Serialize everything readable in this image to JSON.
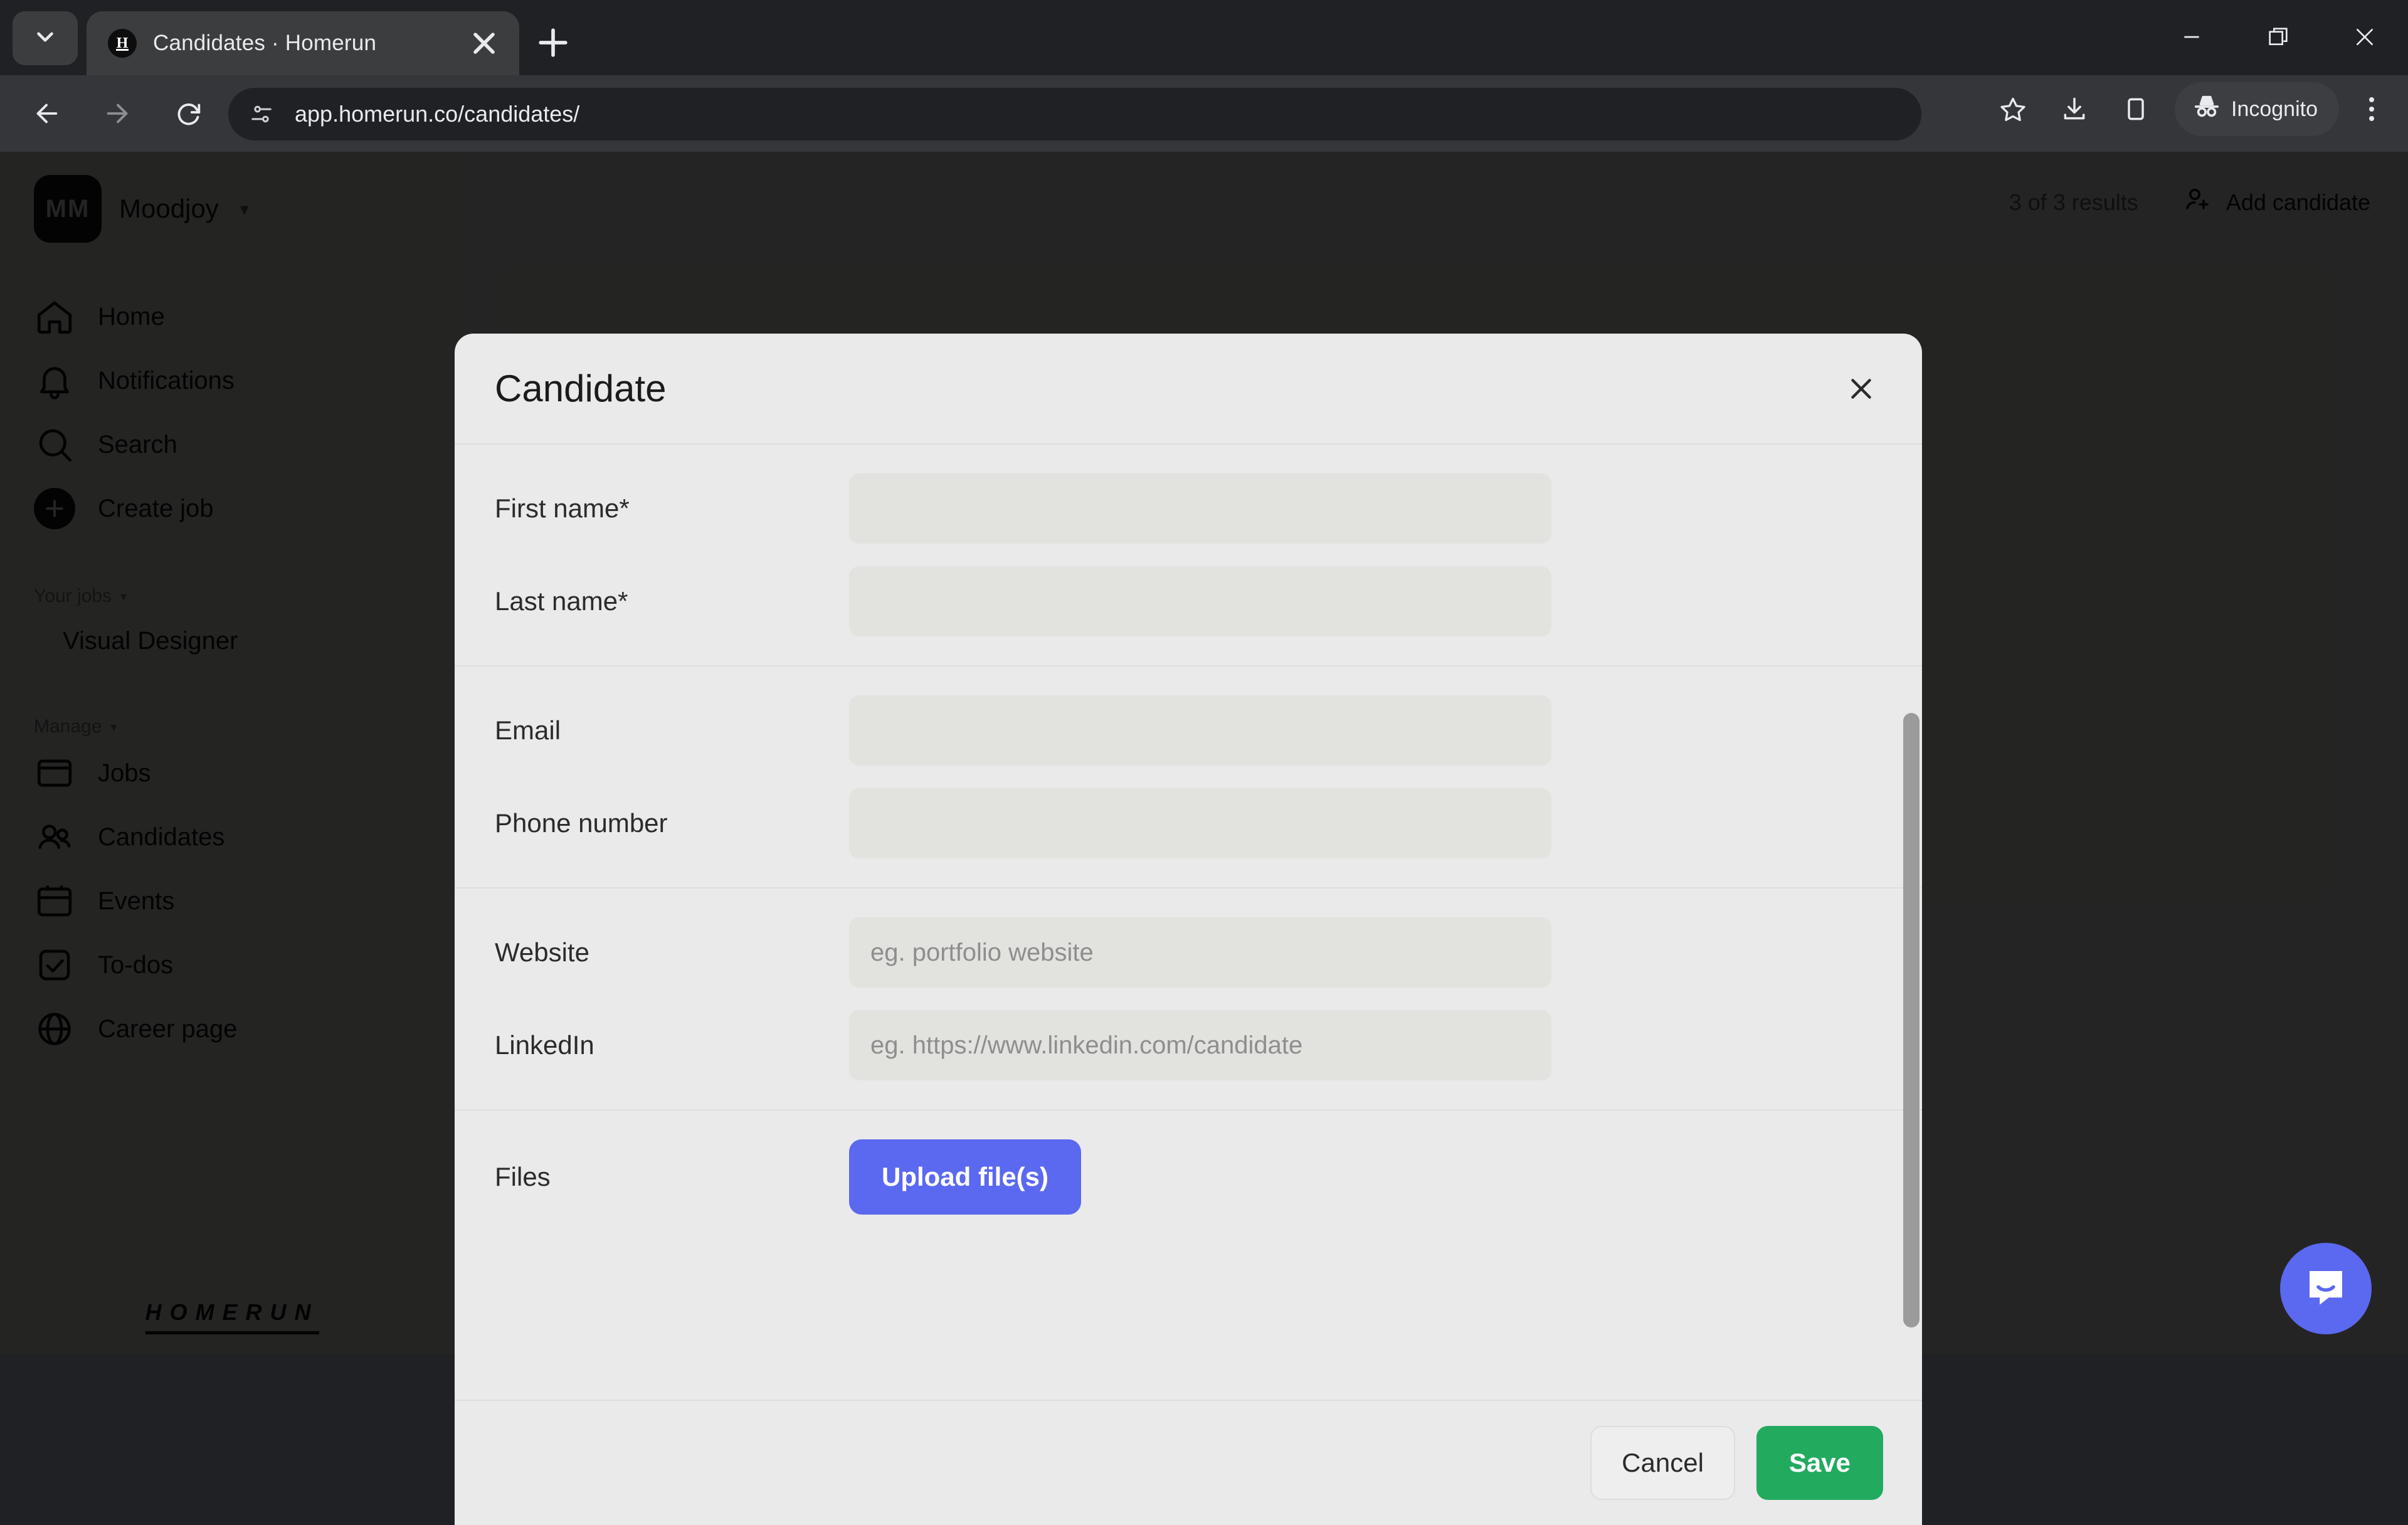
{
  "browser": {
    "tab": {
      "title": "Candidates · Homerun",
      "favicon_letter": "H"
    },
    "tab_list_icon": "chevron-down-icon",
    "new_tab_label": "+",
    "close_tab_label": "×",
    "window_controls": {
      "minimize": "minimize-icon",
      "maximize": "restore-icon",
      "close": "close-icon"
    },
    "omnibox": {
      "url": "app.homerun.co/candidates/",
      "site_info_icon": "tune-icon"
    },
    "toolbar_right": {
      "bookmark_icon": "star-icon",
      "downloads_icon": "download-icon",
      "side_panel_icon": "side-panel-icon",
      "incognito_label": "Incognito",
      "menu_icon": "kebab-menu-icon"
    },
    "nav": {
      "back": "back-arrow-icon",
      "forward": "forward-arrow-icon",
      "reload": "reload-icon"
    }
  },
  "app": {
    "sidebar": {
      "org": {
        "initials": "MM",
        "name": "Moodjoy",
        "caret": "▾"
      },
      "primary_items": [
        {
          "label": "Home",
          "icon": "home-icon"
        },
        {
          "label": "Notifications",
          "icon": "bell-icon"
        },
        {
          "label": "Search",
          "icon": "search-icon"
        },
        {
          "label": "Create job",
          "icon": "plus-circle-icon"
        }
      ],
      "jobs_section": {
        "label": "Your jobs",
        "caret": "▾",
        "items": [
          {
            "label": "Visual Designer"
          }
        ]
      },
      "manage_section": {
        "label": "Manage",
        "caret": "▾",
        "items": [
          {
            "label": "Jobs",
            "icon": "browser-icon"
          },
          {
            "label": "Candidates",
            "icon": "people-icon"
          },
          {
            "label": "Events",
            "icon": "calendar-icon"
          },
          {
            "label": "To-dos",
            "icon": "checkbox-icon"
          },
          {
            "label": "Career page",
            "icon": "globe-icon"
          }
        ]
      },
      "brand": "HOMERUN"
    },
    "content": {
      "results_count": "3 of 3 results",
      "add_candidate": {
        "label": "Add candidate",
        "icon": "add-person-icon"
      }
    }
  },
  "modal": {
    "title": "Candidate",
    "close_icon": "close-icon",
    "groups": [
      {
        "fields": [
          {
            "label": "First name*",
            "value": "",
            "placeholder": "",
            "type": "text"
          },
          {
            "label": "Last name*",
            "value": "",
            "placeholder": "",
            "type": "text"
          }
        ]
      },
      {
        "fields": [
          {
            "label": "Email",
            "value": "",
            "placeholder": "",
            "type": "text"
          },
          {
            "label": "Phone number",
            "value": "",
            "placeholder": "",
            "type": "text"
          }
        ]
      },
      {
        "fields": [
          {
            "label": "Website",
            "value": "",
            "placeholder": "eg. portfolio website",
            "type": "text"
          },
          {
            "label": "LinkedIn",
            "value": "",
            "placeholder": "eg. https://www.linkedin.com/candidate",
            "type": "text"
          }
        ]
      }
    ],
    "files": {
      "label": "Files",
      "upload_label": "Upload file(s)"
    },
    "footer": {
      "cancel_label": "Cancel",
      "save_label": "Save"
    }
  },
  "intercom": {
    "icon": "chat-bubble-icon"
  },
  "colors": {
    "accent_blue": "#5b68f0",
    "save_green": "#22aa5f",
    "modal_bg": "#eaeaea",
    "input_bg": "#e2e2df",
    "chrome_bg": "#202124",
    "toolbar_bg": "#35363a"
  }
}
